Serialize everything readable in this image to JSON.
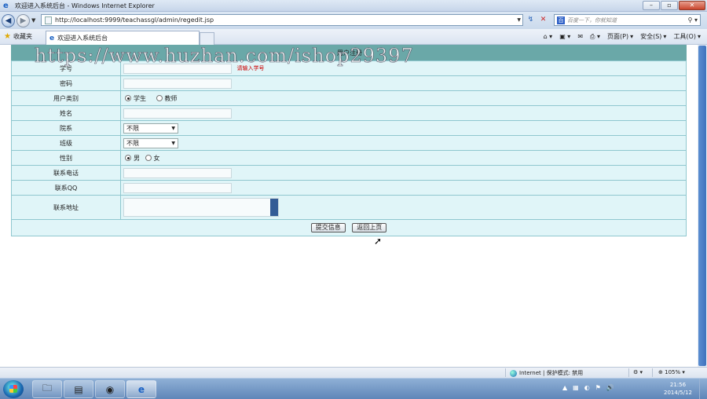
{
  "window": {
    "title": "欢迎进入系统后台 - Windows Internet Explorer",
    "controls": [
      "–",
      "▫",
      "✕"
    ]
  },
  "address": {
    "url": "http://localhost:9999/teachassgl/admin/regedit.jsp",
    "search_placeholder": "百度一下，你就知道"
  },
  "favorites": {
    "label": "收藏夹",
    "tab_title": "欢迎进入系统后台"
  },
  "commands": {
    "page": "页面(P)",
    "safety": "安全(S)",
    "tools": "工具(O)"
  },
  "watermark": "https://www.huzhan.com/ishop29397",
  "form": {
    "header_title": "用户注册",
    "fields": {
      "student_id": {
        "label": "学号",
        "hint": "请输入学号"
      },
      "password": {
        "label": "密码"
      },
      "user_type": {
        "label": "用户类别",
        "options": [
          "学生",
          "教师"
        ]
      },
      "name": {
        "label": "姓名"
      },
      "department": {
        "label": "院系",
        "value": "不限"
      },
      "class": {
        "label": "班级",
        "value": "不限"
      },
      "gender": {
        "label": "性别",
        "options": [
          "男",
          "女"
        ]
      },
      "phone": {
        "label": "联系电话"
      },
      "qq": {
        "label": "联系QQ"
      },
      "address": {
        "label": "联系地址"
      }
    },
    "buttons": {
      "submit": "提交信息",
      "back": "返回上页"
    }
  },
  "status": {
    "zone": "Internet | 保护模式: 禁用",
    "zoom": "105%"
  },
  "taskbar": {
    "time": "21:56",
    "date": "2014/5/12"
  }
}
